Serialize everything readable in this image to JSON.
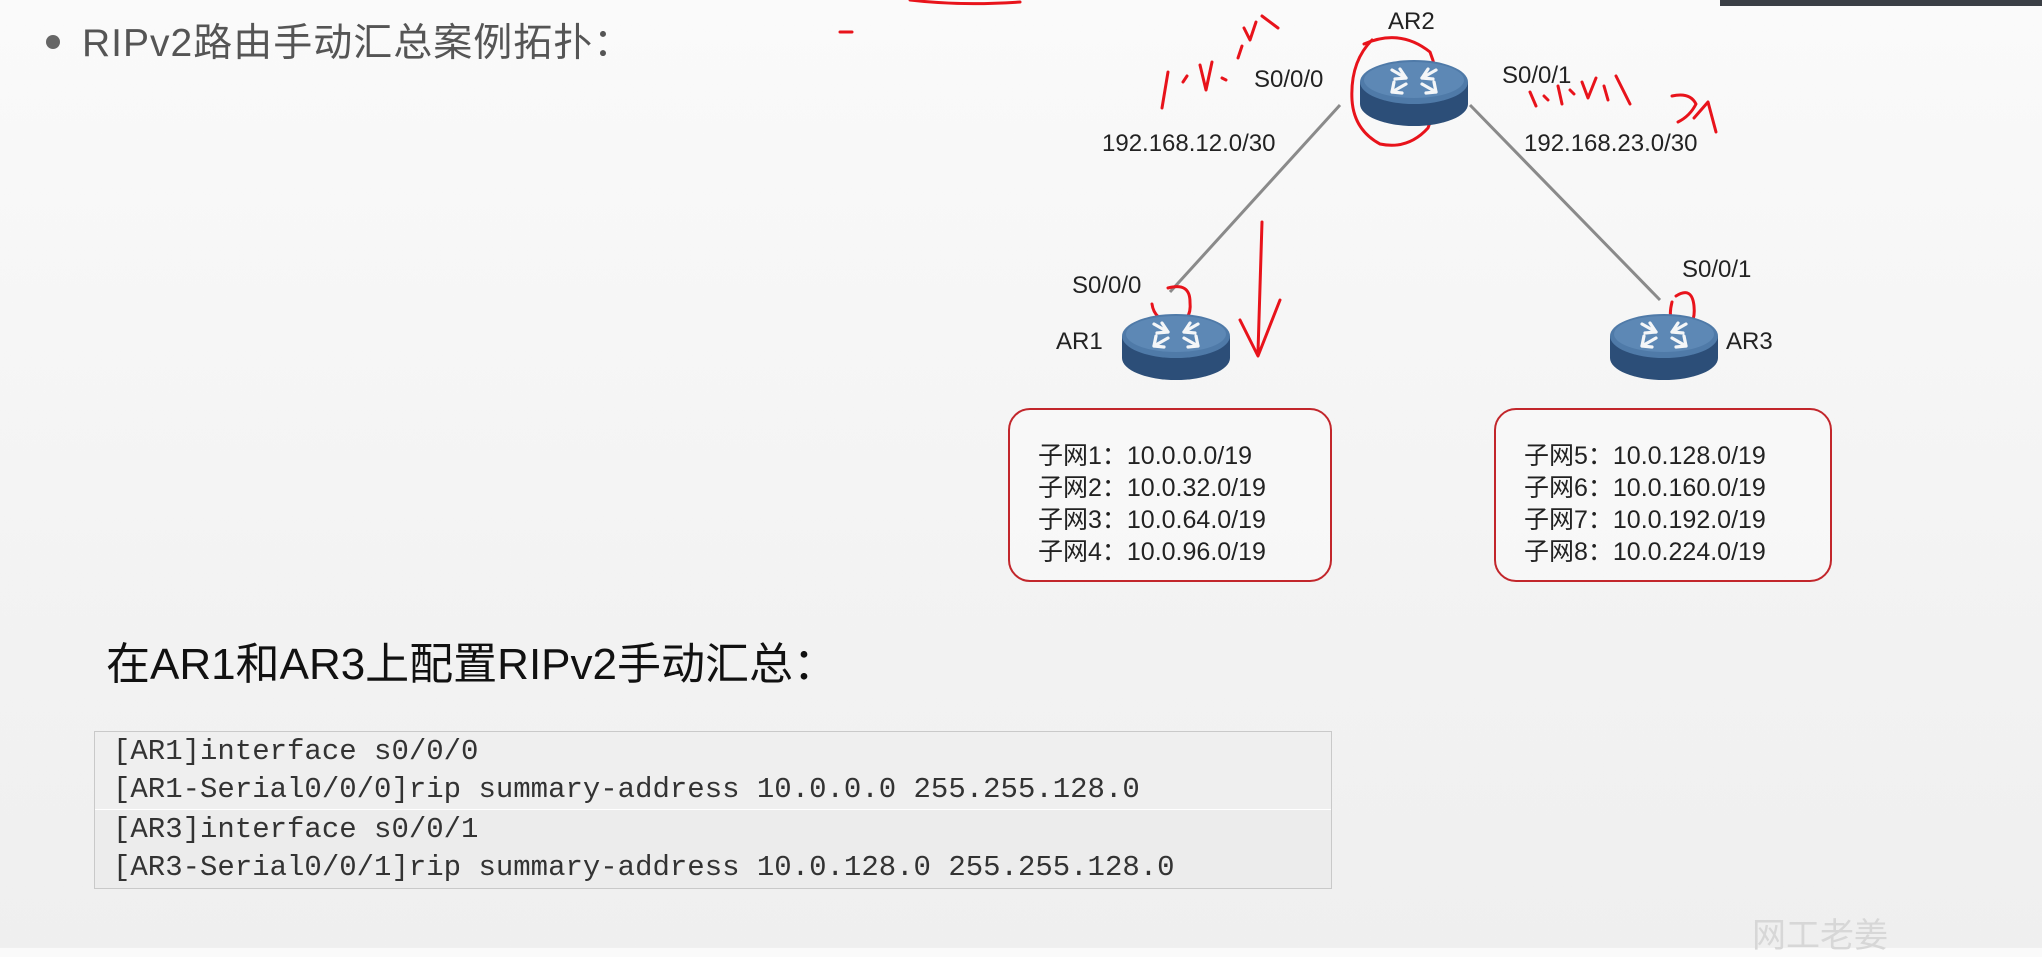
{
  "title": "RIPv2路由手动汇总案例拓扑：",
  "routers": {
    "ar1": {
      "name": "AR1",
      "interface": "S0/0/0"
    },
    "ar2": {
      "name": "AR2",
      "if_left": "S0/0/0",
      "if_right": "S0/0/1"
    },
    "ar3": {
      "name": "AR3",
      "interface": "S0/0/1"
    }
  },
  "links": {
    "left": "192.168.12.0/30",
    "right": "192.168.23.0/30"
  },
  "subnets_ar1": [
    "子网1：10.0.0.0/19",
    "子网2：10.0.32.0/19",
    "子网3：10.0.64.0/19",
    "子网4：10.0.96.0/19"
  ],
  "subnets_ar3": [
    "子网5：10.0.128.0/19",
    "子网6：10.0.160.0/19",
    "子网7：10.0.192.0/19",
    "子网8：10.0.224.0/19"
  ],
  "heading": "在AR1和AR3上配置RIPv2手动汇总：",
  "cli": [
    "[AR1]interface s0/0/0",
    "[AR1-Serial0/0/0]rip summary-address 10.0.0.0 255.255.128.0",
    "[AR3]interface s0/0/1",
    "[AR3-Serial0/0/1]rip summary-address 10.0.128.0 255.255.128.0"
  ],
  "watermark": "网工老姜",
  "colors": {
    "annotation": "#e8131b",
    "box_border": "#c2262b",
    "router_top": "#4f7aa8",
    "router_side": "#2c4e78"
  }
}
